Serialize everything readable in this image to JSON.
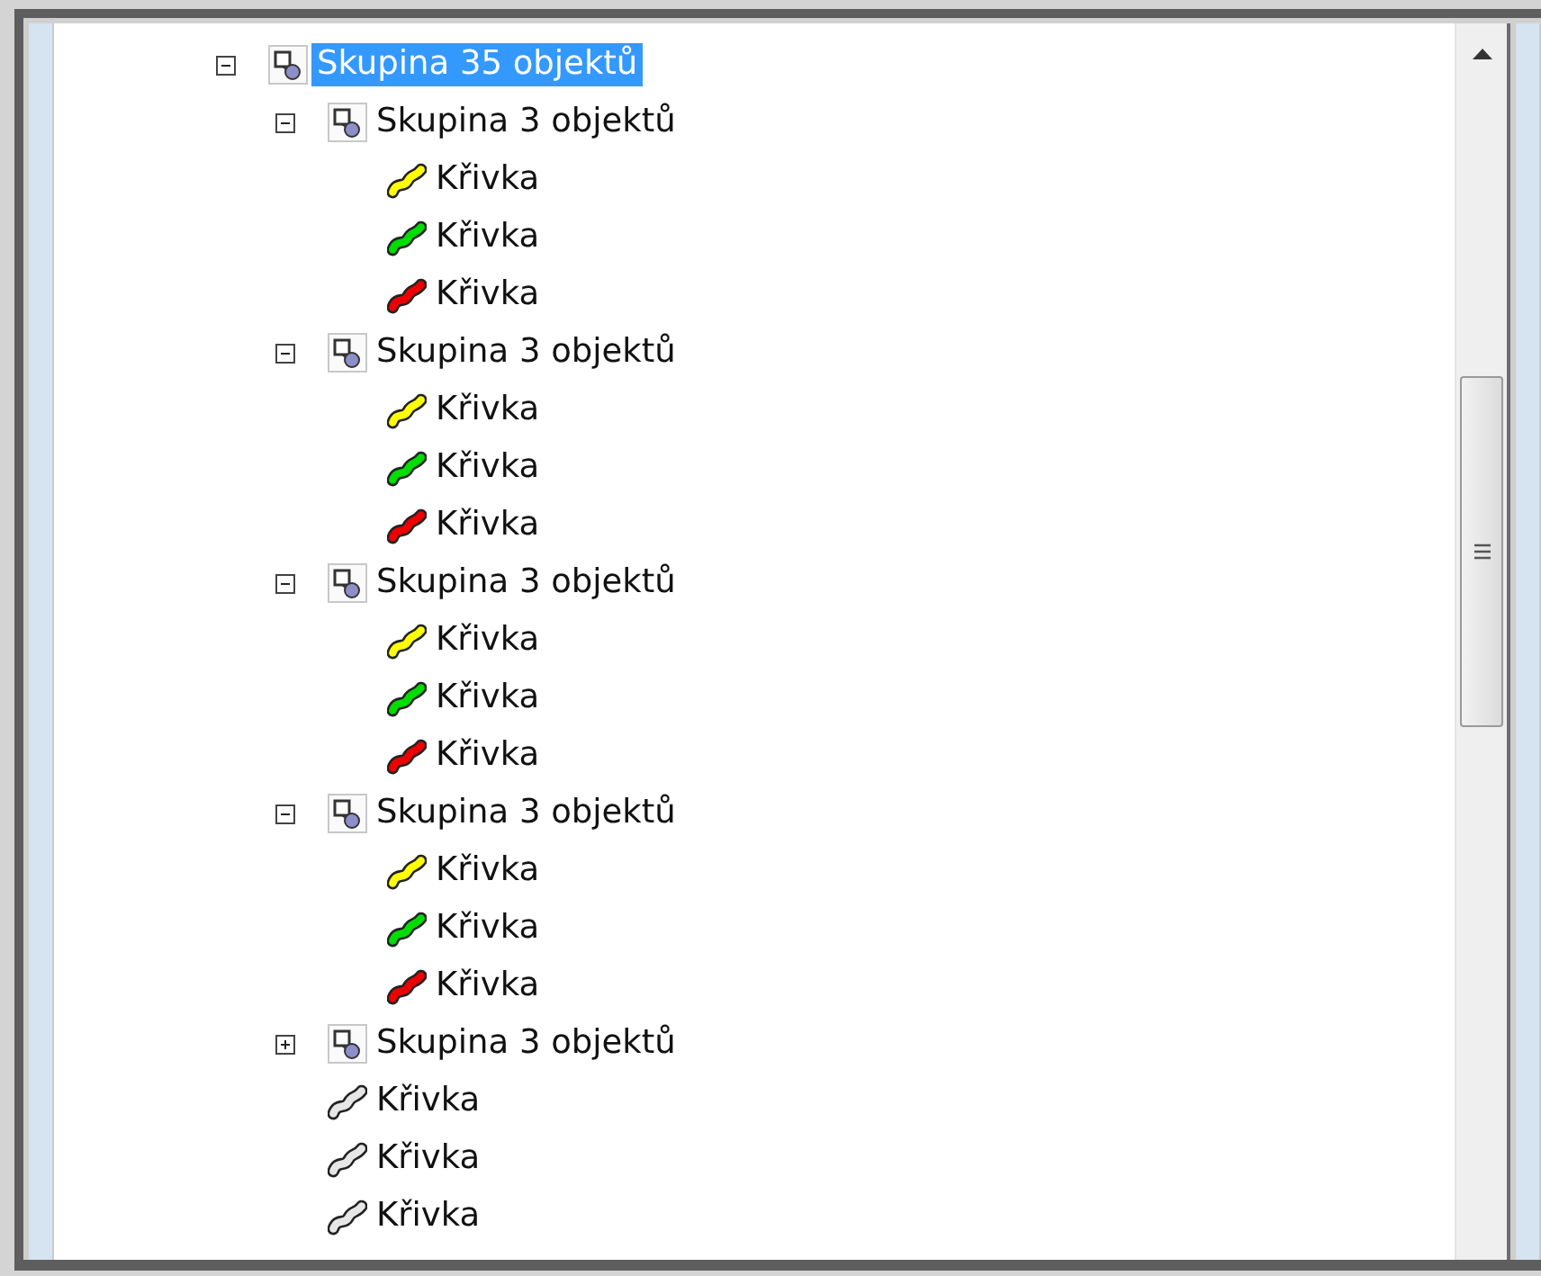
{
  "tree": [
    {
      "kind": "group",
      "label": "Skupina 35 objektů",
      "expanded": true,
      "selected": true,
      "children": [
        {
          "kind": "group",
          "label": "Skupina 3 objektů",
          "expanded": true,
          "selected": false,
          "children": [
            {
              "kind": "curve",
              "label": "Křivka",
              "color": "#ffff00",
              "selected": false
            },
            {
              "kind": "curve",
              "label": "Křivka",
              "color": "#00dd00",
              "selected": false
            },
            {
              "kind": "curve",
              "label": "Křivka",
              "color": "#ee0000",
              "selected": false
            }
          ]
        },
        {
          "kind": "group",
          "label": "Skupina 3 objektů",
          "expanded": true,
          "selected": false,
          "children": [
            {
              "kind": "curve",
              "label": "Křivka",
              "color": "#ffff00",
              "selected": false
            },
            {
              "kind": "curve",
              "label": "Křivka",
              "color": "#00dd00",
              "selected": false
            },
            {
              "kind": "curve",
              "label": "Křivka",
              "color": "#ee0000",
              "selected": false
            }
          ]
        },
        {
          "kind": "group",
          "label": "Skupina 3 objektů",
          "expanded": true,
          "selected": false,
          "children": [
            {
              "kind": "curve",
              "label": "Křivka",
              "color": "#ffff00",
              "selected": false
            },
            {
              "kind": "curve",
              "label": "Křivka",
              "color": "#00dd00",
              "selected": false
            },
            {
              "kind": "curve",
              "label": "Křivka",
              "color": "#ee0000",
              "selected": false
            }
          ]
        },
        {
          "kind": "group",
          "label": "Skupina 3 objektů",
          "expanded": true,
          "selected": false,
          "children": [
            {
              "kind": "curve",
              "label": "Křivka",
              "color": "#ffff00",
              "selected": false
            },
            {
              "kind": "curve",
              "label": "Křivka",
              "color": "#00dd00",
              "selected": false
            },
            {
              "kind": "curve",
              "label": "Křivka",
              "color": "#ee0000",
              "selected": false
            }
          ]
        },
        {
          "kind": "group",
          "label": "Skupina 3 objektů",
          "expanded": false,
          "selected": false
        },
        {
          "kind": "curve",
          "label": "Křivka",
          "color": "#e6e6e6",
          "selected": false
        },
        {
          "kind": "curve",
          "label": "Křivka",
          "color": "#e6e6e6",
          "selected": false
        },
        {
          "kind": "curve",
          "label": "Křivka",
          "color": "#e6e6e6",
          "selected": false
        }
      ]
    }
  ]
}
